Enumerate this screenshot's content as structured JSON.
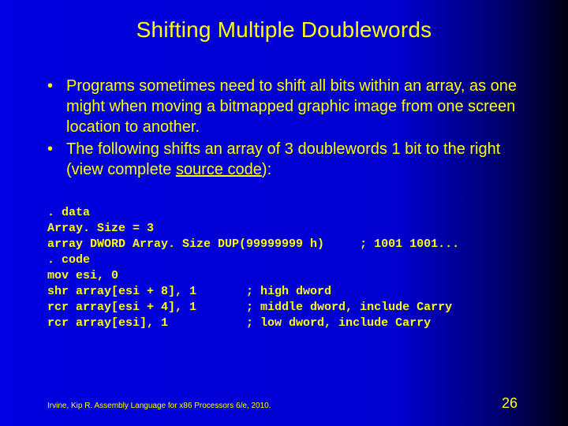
{
  "title": "Shifting Multiple Doublewords",
  "bullets": [
    {
      "text": "Programs sometimes need to shift all bits within an array, as one might when moving a bitmapped graphic image from one screen location to another."
    },
    {
      "prefix": "The following shifts an array of 3 doublewords 1 bit to the right (view complete ",
      "link": "source code",
      "suffix": "):"
    }
  ],
  "code": ". data\nArray. Size = 3\narray DWORD Array. Size DUP(99999999 h)     ; 1001 1001...\n. code\nmov esi, 0\nshr array[esi + 8], 1       ; high dword\nrcr array[esi + 4], 1       ; middle dword, include Carry\nrcr array[esi], 1           ; low dword, include Carry",
  "footer": "Irvine, Kip R. Assembly Language for x86 Processors 6/e, 2010.",
  "page": "26"
}
